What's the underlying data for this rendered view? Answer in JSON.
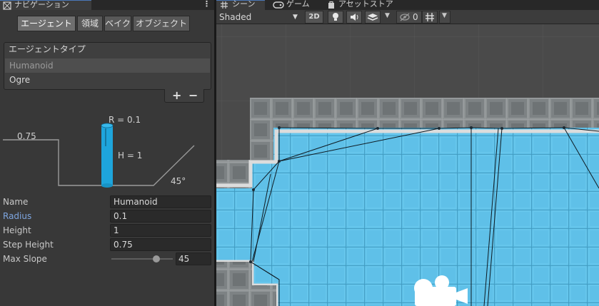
{
  "nav_tab": {
    "title": "ナビゲーション",
    "menu_glyph": "⋮"
  },
  "segments": [
    "エージェント",
    "領域",
    "ベイク",
    "オブジェクト"
  ],
  "agent_types": {
    "header": "エージェントタイプ",
    "items": [
      "Humanoid",
      "Ogre"
    ],
    "selected": "Humanoid",
    "add_glyph": "+",
    "remove_glyph": "−"
  },
  "diagram": {
    "radius_label": "R = 0.1",
    "height_label": "H = 1",
    "step_label": "0.75",
    "slope_label": "45°"
  },
  "properties": [
    {
      "label": "Name",
      "value": "Humanoid"
    },
    {
      "label": "Radius",
      "value": "0.1"
    },
    {
      "label": "Height",
      "value": "1"
    },
    {
      "label": "Step Height",
      "value": "0.75"
    }
  ],
  "max_slope": {
    "label": "Max Slope",
    "value": "45",
    "fraction": 0.72
  },
  "scene_tabs": [
    "シーン",
    "ゲーム",
    "アセットストア"
  ],
  "scene_toolbar": {
    "draw_mode": "Shaded",
    "mode_2d": "2D",
    "hidden_count": "0"
  },
  "colors": {
    "accent": "#4a78b8",
    "navmesh": "#5bbde4",
    "agent": "#1ea5dc",
    "selected_label": "#7ea6e0"
  }
}
